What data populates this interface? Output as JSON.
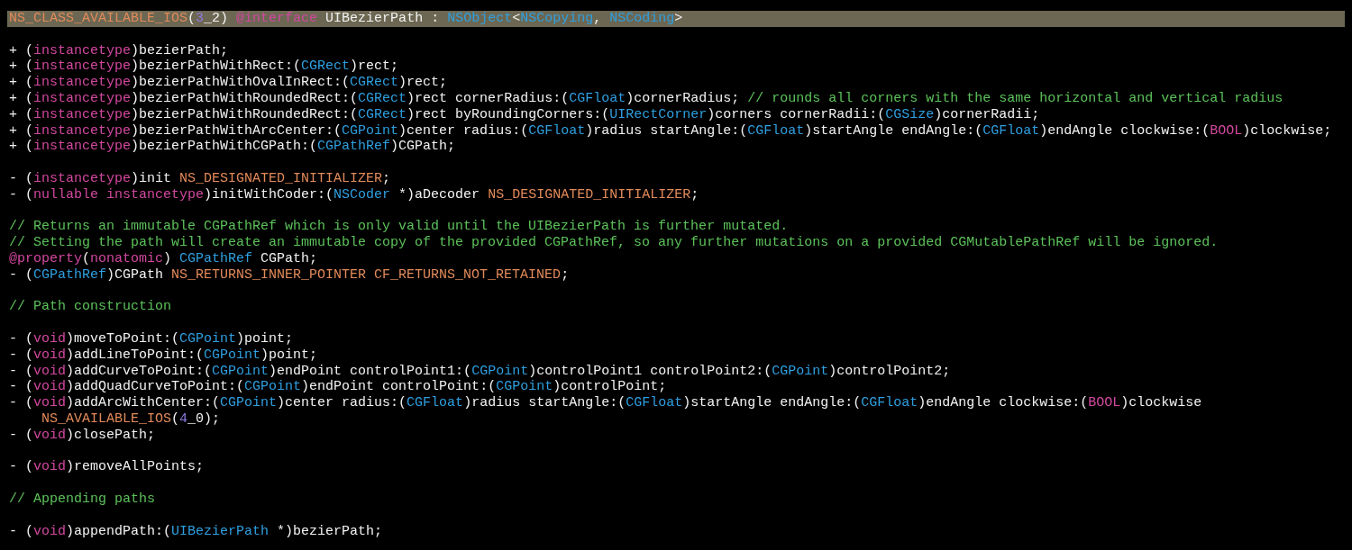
{
  "editor": {
    "blocks": [
      {
        "lines": [
          {
            "highlighted": true,
            "tokens": [
              {
                "kind": "macro",
                "text": "NS_CLASS_AVAILABLE_IOS"
              },
              {
                "kind": "plain",
                "text": "("
              },
              {
                "kind": "number",
                "text": "3"
              },
              {
                "kind": "plain",
                "text": "_2) "
              },
              {
                "kind": "keyword",
                "text": "@interface"
              },
              {
                "kind": "plain",
                "text": " UIBezierPath : "
              },
              {
                "kind": "type",
                "text": "NSObject"
              },
              {
                "kind": "plain",
                "text": "<"
              },
              {
                "kind": "type",
                "text": "NSCopying"
              },
              {
                "kind": "plain",
                "text": ", "
              },
              {
                "kind": "type",
                "text": "NSCoding"
              },
              {
                "kind": "plain",
                "text": ">"
              }
            ]
          }
        ]
      },
      {
        "lines": [
          {
            "highlighted": false,
            "tokens": [
              {
                "kind": "plain",
                "text": "+ ("
              },
              {
                "kind": "keyword",
                "text": "instancetype"
              },
              {
                "kind": "plain",
                "text": ")bezierPath;"
              }
            ]
          },
          {
            "highlighted": false,
            "tokens": [
              {
                "kind": "plain",
                "text": "+ ("
              },
              {
                "kind": "keyword",
                "text": "instancetype"
              },
              {
                "kind": "plain",
                "text": ")bezierPathWithRect:("
              },
              {
                "kind": "type",
                "text": "CGRect"
              },
              {
                "kind": "plain",
                "text": ")rect;"
              }
            ]
          },
          {
            "highlighted": false,
            "tokens": [
              {
                "kind": "plain",
                "text": "+ ("
              },
              {
                "kind": "keyword",
                "text": "instancetype"
              },
              {
                "kind": "plain",
                "text": ")bezierPathWithOvalInRect:("
              },
              {
                "kind": "type",
                "text": "CGRect"
              },
              {
                "kind": "plain",
                "text": ")rect;"
              }
            ]
          },
          {
            "highlighted": false,
            "tokens": [
              {
                "kind": "plain",
                "text": "+ ("
              },
              {
                "kind": "keyword",
                "text": "instancetype"
              },
              {
                "kind": "plain",
                "text": ")bezierPathWithRoundedRect:("
              },
              {
                "kind": "type",
                "text": "CGRect"
              },
              {
                "kind": "plain",
                "text": ")rect cornerRadius:("
              },
              {
                "kind": "type",
                "text": "CGFloat"
              },
              {
                "kind": "plain",
                "text": ")cornerRadius; "
              },
              {
                "kind": "comment",
                "text": "// rounds all corners with the same horizontal and vertical radius"
              }
            ]
          },
          {
            "highlighted": false,
            "tokens": [
              {
                "kind": "plain",
                "text": "+ ("
              },
              {
                "kind": "keyword",
                "text": "instancetype"
              },
              {
                "kind": "plain",
                "text": ")bezierPathWithRoundedRect:("
              },
              {
                "kind": "type",
                "text": "CGRect"
              },
              {
                "kind": "plain",
                "text": ")rect byRoundingCorners:("
              },
              {
                "kind": "type",
                "text": "UIRectCorner"
              },
              {
                "kind": "plain",
                "text": ")corners cornerRadii:("
              },
              {
                "kind": "type",
                "text": "CGSize"
              },
              {
                "kind": "plain",
                "text": ")cornerRadii;"
              }
            ]
          },
          {
            "highlighted": false,
            "tokens": [
              {
                "kind": "plain",
                "text": "+ ("
              },
              {
                "kind": "keyword",
                "text": "instancetype"
              },
              {
                "kind": "plain",
                "text": ")bezierPathWithArcCenter:("
              },
              {
                "kind": "type",
                "text": "CGPoint"
              },
              {
                "kind": "plain",
                "text": ")center radius:("
              },
              {
                "kind": "type",
                "text": "CGFloat"
              },
              {
                "kind": "plain",
                "text": ")radius startAngle:("
              },
              {
                "kind": "type",
                "text": "CGFloat"
              },
              {
                "kind": "plain",
                "text": ")startAngle endAngle:("
              },
              {
                "kind": "type",
                "text": "CGFloat"
              },
              {
                "kind": "plain",
                "text": ")endAngle clockwise:("
              },
              {
                "kind": "keyword",
                "text": "BOOL"
              },
              {
                "kind": "plain",
                "text": ")clockwise;"
              }
            ]
          },
          {
            "highlighted": false,
            "tokens": [
              {
                "kind": "plain",
                "text": "+ ("
              },
              {
                "kind": "keyword",
                "text": "instancetype"
              },
              {
                "kind": "plain",
                "text": ")bezierPathWithCGPath:("
              },
              {
                "kind": "type",
                "text": "CGPathRef"
              },
              {
                "kind": "plain",
                "text": ")CGPath;"
              }
            ]
          }
        ]
      },
      {
        "lines": [
          {
            "highlighted": false,
            "tokens": [
              {
                "kind": "plain",
                "text": "- ("
              },
              {
                "kind": "keyword",
                "text": "instancetype"
              },
              {
                "kind": "plain",
                "text": ")init "
              },
              {
                "kind": "macro",
                "text": "NS_DESIGNATED_INITIALIZER"
              },
              {
                "kind": "plain",
                "text": ";"
              }
            ]
          },
          {
            "highlighted": false,
            "tokens": [
              {
                "kind": "plain",
                "text": "- ("
              },
              {
                "kind": "keyword",
                "text": "nullable instancetype"
              },
              {
                "kind": "plain",
                "text": ")initWithCoder:("
              },
              {
                "kind": "type",
                "text": "NSCoder"
              },
              {
                "kind": "plain",
                "text": " *)aDecoder "
              },
              {
                "kind": "macro",
                "text": "NS_DESIGNATED_INITIALIZER"
              },
              {
                "kind": "plain",
                "text": ";"
              }
            ]
          }
        ]
      },
      {
        "lines": [
          {
            "highlighted": false,
            "tokens": [
              {
                "kind": "comment",
                "text": "// Returns an immutable CGPathRef which is only valid until the UIBezierPath is further mutated."
              }
            ]
          },
          {
            "highlighted": false,
            "tokens": [
              {
                "kind": "comment",
                "text": "// Setting the path will create an immutable copy of the provided CGPathRef, so any further mutations on a provided CGMutablePathRef will be ignored."
              }
            ]
          },
          {
            "highlighted": false,
            "tokens": [
              {
                "kind": "keyword",
                "text": "@property"
              },
              {
                "kind": "plain",
                "text": "("
              },
              {
                "kind": "keyword",
                "text": "nonatomic"
              },
              {
                "kind": "plain",
                "text": ") "
              },
              {
                "kind": "type",
                "text": "CGPathRef"
              },
              {
                "kind": "plain",
                "text": " CGPath;"
              }
            ]
          },
          {
            "highlighted": false,
            "tokens": [
              {
                "kind": "plain",
                "text": "- ("
              },
              {
                "kind": "type",
                "text": "CGPathRef"
              },
              {
                "kind": "plain",
                "text": ")CGPath "
              },
              {
                "kind": "macro",
                "text": "NS_RETURNS_INNER_POINTER CF_RETURNS_NOT_RETAINED"
              },
              {
                "kind": "plain",
                "text": ";"
              }
            ]
          }
        ]
      },
      {
        "lines": [
          {
            "highlighted": false,
            "tokens": [
              {
                "kind": "comment",
                "text": "// Path construction"
              }
            ]
          }
        ]
      },
      {
        "lines": [
          {
            "highlighted": false,
            "tokens": [
              {
                "kind": "plain",
                "text": "- ("
              },
              {
                "kind": "keyword",
                "text": "void"
              },
              {
                "kind": "plain",
                "text": ")moveToPoint:("
              },
              {
                "kind": "type",
                "text": "CGPoint"
              },
              {
                "kind": "plain",
                "text": ")point;"
              }
            ]
          },
          {
            "highlighted": false,
            "tokens": [
              {
                "kind": "plain",
                "text": "- ("
              },
              {
                "kind": "keyword",
                "text": "void"
              },
              {
                "kind": "plain",
                "text": ")addLineToPoint:("
              },
              {
                "kind": "type",
                "text": "CGPoint"
              },
              {
                "kind": "plain",
                "text": ")point;"
              }
            ]
          },
          {
            "highlighted": false,
            "tokens": [
              {
                "kind": "plain",
                "text": "- ("
              },
              {
                "kind": "keyword",
                "text": "void"
              },
              {
                "kind": "plain",
                "text": ")addCurveToPoint:("
              },
              {
                "kind": "type",
                "text": "CGPoint"
              },
              {
                "kind": "plain",
                "text": ")endPoint controlPoint1:("
              },
              {
                "kind": "type",
                "text": "CGPoint"
              },
              {
                "kind": "plain",
                "text": ")controlPoint1 controlPoint2:("
              },
              {
                "kind": "type",
                "text": "CGPoint"
              },
              {
                "kind": "plain",
                "text": ")controlPoint2;"
              }
            ]
          },
          {
            "highlighted": false,
            "tokens": [
              {
                "kind": "plain",
                "text": "- ("
              },
              {
                "kind": "keyword",
                "text": "void"
              },
              {
                "kind": "plain",
                "text": ")addQuadCurveToPoint:("
              },
              {
                "kind": "type",
                "text": "CGPoint"
              },
              {
                "kind": "plain",
                "text": ")endPoint controlPoint:("
              },
              {
                "kind": "type",
                "text": "CGPoint"
              },
              {
                "kind": "plain",
                "text": ")controlPoint;"
              }
            ]
          },
          {
            "highlighted": false,
            "tokens": [
              {
                "kind": "plain",
                "text": "- ("
              },
              {
                "kind": "keyword",
                "text": "void"
              },
              {
                "kind": "plain",
                "text": ")addArcWithCenter:("
              },
              {
                "kind": "type",
                "text": "CGPoint"
              },
              {
                "kind": "plain",
                "text": ")center radius:("
              },
              {
                "kind": "type",
                "text": "CGFloat"
              },
              {
                "kind": "plain",
                "text": ")radius startAngle:("
              },
              {
                "kind": "type",
                "text": "CGFloat"
              },
              {
                "kind": "plain",
                "text": ")startAngle endAngle:("
              },
              {
                "kind": "type",
                "text": "CGFloat"
              },
              {
                "kind": "plain",
                "text": ")endAngle clockwise:("
              },
              {
                "kind": "keyword",
                "text": "BOOL"
              },
              {
                "kind": "plain",
                "text": ")clockwise"
              }
            ]
          },
          {
            "highlighted": false,
            "wrapped": true,
            "tokens": [
              {
                "kind": "macro",
                "text": "NS_AVAILABLE_IOS"
              },
              {
                "kind": "plain",
                "text": "("
              },
              {
                "kind": "number",
                "text": "4"
              },
              {
                "kind": "plain",
                "text": "_0);"
              }
            ]
          },
          {
            "highlighted": false,
            "tokens": [
              {
                "kind": "plain",
                "text": "- ("
              },
              {
                "kind": "keyword",
                "text": "void"
              },
              {
                "kind": "plain",
                "text": ")closePath;"
              }
            ]
          }
        ]
      },
      {
        "lines": [
          {
            "highlighted": false,
            "tokens": [
              {
                "kind": "plain",
                "text": "- ("
              },
              {
                "kind": "keyword",
                "text": "void"
              },
              {
                "kind": "plain",
                "text": ")removeAllPoints;"
              }
            ]
          }
        ]
      },
      {
        "lines": [
          {
            "highlighted": false,
            "tokens": [
              {
                "kind": "comment",
                "text": "// Appending paths"
              }
            ]
          }
        ]
      },
      {
        "lines": [
          {
            "highlighted": false,
            "tokens": [
              {
                "kind": "plain",
                "text": "- ("
              },
              {
                "kind": "keyword",
                "text": "void"
              },
              {
                "kind": "plain",
                "text": ")appendPath:("
              },
              {
                "kind": "type",
                "text": "UIBezierPath"
              },
              {
                "kind": "plain",
                "text": " *)bezierPath;"
              }
            ]
          }
        ]
      }
    ]
  }
}
